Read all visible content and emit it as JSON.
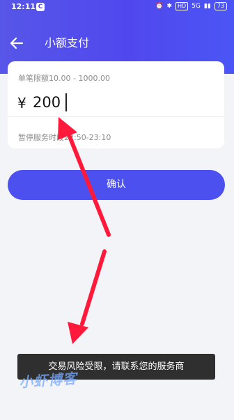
{
  "status_bar": {
    "time": "12:11",
    "hd_label": "HD",
    "network_label": "5G",
    "battery": "73"
  },
  "nav": {
    "title": "小额支付"
  },
  "card": {
    "limit_text": "单笔限额10.00 - 1000.00",
    "currency": "¥",
    "amount": "200",
    "service_hours": "暂停服务时段22:50-23:10"
  },
  "confirm_label": "确认",
  "toast": "交易风险受限，请联系您的服务商",
  "watermark": "小虾博客",
  "colors": {
    "brand": "#4c50ee",
    "annotation_arrow": "#ff1a3c"
  }
}
